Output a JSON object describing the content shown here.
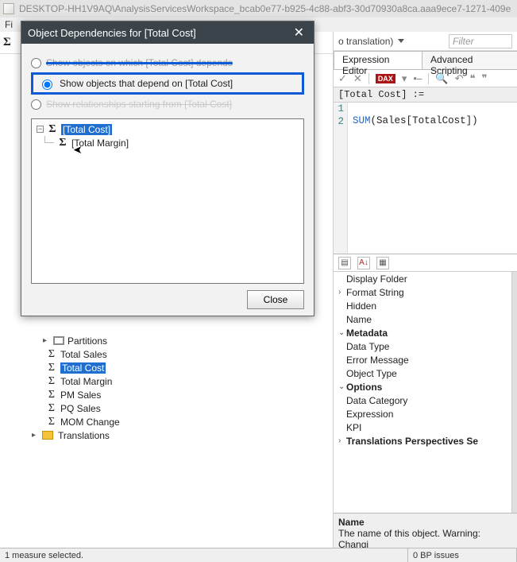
{
  "windowTitle": "DESKTOP-HH1V9AQ\\AnalysisServicesWorkspace_bcab0e77-b925-4c88-abf3-30d70930a8ca.aaa9ece7-1271-409e",
  "menu": {
    "file": "Fi"
  },
  "dialog": {
    "title": "Object Dependencies for [Total Cost]",
    "opt1": "Show objects on which [Total Cost] depends",
    "opt2": "Show objects that depend on [Total Cost]",
    "opt3": "Show relationships starting from [Total Cost]",
    "tree": {
      "root": "[Total Cost]",
      "child": "[Total Margin]"
    },
    "closeBtn": "Close"
  },
  "modelTree": {
    "partitions": "Partitions",
    "items": [
      "Total Sales",
      "Total Cost",
      "Total Margin",
      "PM Sales",
      "PQ Sales",
      "MOM Change"
    ],
    "translations": "Translations",
    "selectedIndex": 1
  },
  "rightTop": {
    "transLabel": "o translation)",
    "filterPlaceholder": "Filter"
  },
  "tabs": {
    "editor": "Expression Editor",
    "scripting": "Advanced Scripting"
  },
  "exprTool": {
    "daxBadge": "DAX"
  },
  "exprHeader": "[Total Cost] :=",
  "code": {
    "l1": "",
    "fn": "SUM",
    "open": "(",
    "tbl": "Sales",
    "br1": "[",
    "col": "TotalCost",
    "br2": "]",
    "close": ")"
  },
  "props": {
    "rows": [
      {
        "caret": "",
        "name": "Display Folder",
        "cat": false
      },
      {
        "caret": "›",
        "name": "Format String",
        "cat": false
      },
      {
        "caret": "",
        "name": "Hidden",
        "cat": false
      },
      {
        "caret": "",
        "name": "Name",
        "cat": false
      },
      {
        "caret": "⌄",
        "name": "Metadata",
        "cat": true
      },
      {
        "caret": "",
        "name": "Data Type",
        "cat": false
      },
      {
        "caret": "",
        "name": "Error Message",
        "cat": false
      },
      {
        "caret": "",
        "name": "Object Type",
        "cat": false
      },
      {
        "caret": "⌄",
        "name": "Options",
        "cat": true
      },
      {
        "caret": "",
        "name": "Data Category",
        "cat": false
      },
      {
        "caret": "",
        "name": "Expression",
        "cat": false
      },
      {
        "caret": "",
        "name": "KPI",
        "cat": false
      },
      {
        "caret": "›",
        "name": "Translations  Perspectives  Se",
        "cat": true
      }
    ],
    "descTitle": "Name",
    "descBody": "The name of this object. Warning: Changi"
  },
  "status": {
    "left": "1 measure selected.",
    "right": "0 BP issues"
  }
}
